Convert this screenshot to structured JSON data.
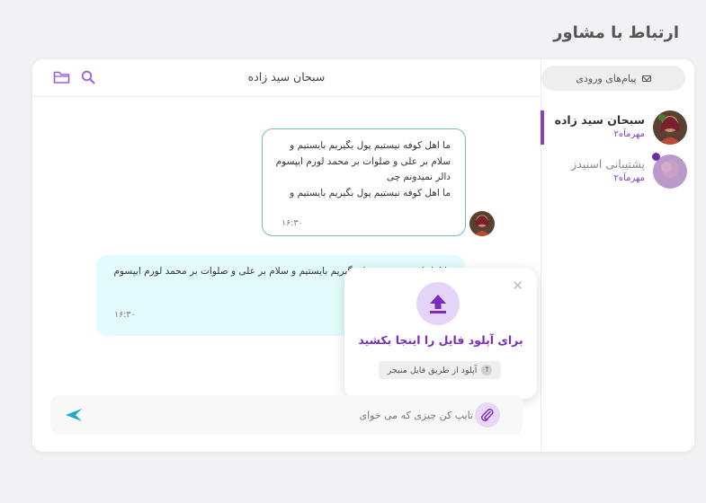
{
  "page": {
    "title": "ارتباط با مشاور"
  },
  "sidebar": {
    "inbox_label": "پیام‌های ورودی",
    "contacts": [
      {
        "name": "سبحان سید زاده",
        "sub": "مهرمآه۲",
        "active": true
      },
      {
        "name": "پشتیبانی اسنیدز",
        "sub": "مهرمآه۲",
        "active": false,
        "unread": true
      }
    ]
  },
  "chat": {
    "header_name": "سبحان سید زاده",
    "messages": [
      {
        "direction": "out",
        "lines": [
          "ما اهل کوفه نیستیم پول بگیریم بایستیم و",
          "سلام بر علی و صلوات بر محمد لورم ایپسوم",
          "دالر نمیدونم چی",
          "ما اهل کوفه نیستیم پول بگیریم بایستیم و"
        ],
        "time": "۱۶:۳۰"
      },
      {
        "direction": "in",
        "text": "ما اهل کوفه نیستیم پول بگیریم بایستیم و سلام بر علی و صلوات بر محمد لورم ایپسوم",
        "time": "۱۶:۳۰"
      }
    ]
  },
  "upload_popup": {
    "title": "برای آپلود فایل را اینجا بکشید",
    "button_label": "آپلود از طریق فایل منیجر"
  },
  "composer": {
    "placeholder": "تایپ کن چیزی که می خوای"
  },
  "colors": {
    "accent": "#8a3fc6",
    "outgoing_border": "#73bfb8",
    "incoming_bg": "#e3fbfb",
    "send": "#1fa9c9"
  }
}
